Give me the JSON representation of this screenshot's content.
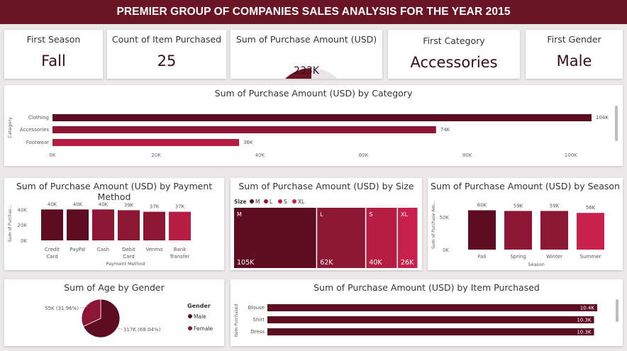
{
  "title": "PREMIER GROUP OF COMPANIES SALES ANALYSIS FOR THE YEAR 2015",
  "colors": {
    "dark": "#5d0c22",
    "mid": "#8c1634",
    "red": "#b51d43",
    "pink": "#c8204c",
    "title_bg": "#6b1425"
  },
  "kpis": {
    "first_season": {
      "label": "First Season",
      "value": "Fall"
    },
    "count_items": {
      "label": "Count of Item Purchased",
      "value": "25"
    },
    "sum_purchase": {
      "label": "Sum of Purchase Amount (USD)",
      "value": "233K",
      "fraction": 0.5
    },
    "first_category": {
      "label": "First Category",
      "value": "Accessories"
    },
    "first_gender": {
      "label": "First Gender",
      "value": "Male"
    }
  },
  "chart_data": [
    {
      "id": "category",
      "type": "bar",
      "orientation": "horizontal",
      "title": "Sum of Purchase Amount (USD) by Category",
      "ylabel": "Category",
      "categories": [
        "Clothing",
        "Accessories",
        "Footwear"
      ],
      "values": [
        104,
        74,
        36
      ],
      "data_labels": [
        "104K",
        "74K",
        "36K"
      ],
      "ticks": [
        "0K",
        "20K",
        "40K",
        "60K",
        "80K",
        "100K"
      ],
      "xlim": [
        0,
        104
      ]
    },
    {
      "id": "payment",
      "type": "bar",
      "title": "Sum of Purchase Amount (USD) by Payment Method",
      "xlabel": "Payment Method",
      "ylabel": "Sum of Purchas...",
      "categories": [
        [
          "Credit",
          "Card"
        ],
        [
          "PayPal"
        ],
        [
          "Cash"
        ],
        [
          "Debit",
          "Card"
        ],
        [
          "Venmo"
        ],
        [
          "Bank",
          "Transfer"
        ]
      ],
      "values": [
        40,
        40,
        40,
        39,
        37,
        37
      ],
      "data_labels": [
        "40K",
        "40K",
        "40K",
        "39K",
        "37K",
        "37K"
      ],
      "ticks": [
        "0K",
        "20K",
        "40K"
      ],
      "ylim": [
        0,
        44
      ]
    },
    {
      "id": "size",
      "type": "treemap",
      "title": "Sum of Purchase Amount (USD) by Size",
      "legend_title": "Size",
      "legend": [
        "M",
        "L",
        "S",
        "XL"
      ],
      "categories": [
        "M",
        "L",
        "S",
        "XL"
      ],
      "values": [
        105,
        62,
        40,
        26
      ],
      "data_labels": [
        "105K",
        "62K",
        "40K",
        "26K"
      ]
    },
    {
      "id": "season",
      "type": "bar",
      "title": "Sum of Purchase Amount (USD) by Season",
      "xlabel": "Season",
      "ylabel": "Sum of Purchase Am...",
      "categories": [
        "Fall",
        "Spring",
        "Winter",
        "Summer"
      ],
      "values": [
        60,
        59,
        59,
        56
      ],
      "data_labels": [
        "60K",
        "59K",
        "59K",
        "56K"
      ],
      "ticks": [
        "0K",
        "50K"
      ],
      "ylim": [
        0,
        66
      ]
    },
    {
      "id": "gender",
      "type": "pie",
      "title": "Sum of Age by Gender",
      "legend_title": "Gender",
      "categories": [
        "Male",
        "Female"
      ],
      "values": [
        68.04,
        31.96
      ],
      "data_labels": [
        "117K (68.04%)",
        "55K (31.96%)"
      ]
    },
    {
      "id": "items",
      "type": "bar",
      "orientation": "horizontal",
      "title": "Sum of Purchase Amount (USD) by Item Purchased",
      "ylabel": "Item Purchased",
      "categories": [
        "Blouse",
        "Shirt",
        "Dress"
      ],
      "values": [
        10.4,
        10.3,
        10.3
      ],
      "data_labels": [
        "10.4K",
        "10.3K",
        "10.3K"
      ],
      "xlim": [
        0,
        10.4
      ]
    }
  ]
}
